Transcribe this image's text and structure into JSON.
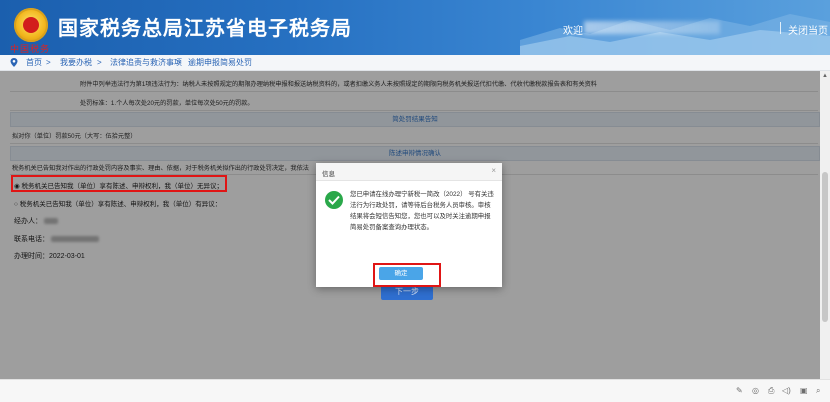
{
  "header": {
    "site_title": "国家税务总局江苏省电子税务局",
    "emblem_text": "中国税务",
    "welcome_label": "欢迎",
    "logout_label": "关闭当页"
  },
  "breadcrumb": {
    "items": [
      "首页",
      "我要办税",
      "法律追责与救济事项",
      "逾期申报简易处罚"
    ],
    "separator": ">"
  },
  "form": {
    "row1_text": "附件中列举违法行为第1项违法行为：纳税人未按照规定的期限办理纳税申报和报送纳税资料的，或者扣缴义务人未按照规定的期限向税务机关报送代扣代缴、代收代缴税款报告表和有关资料",
    "row2_text": "处罚标准：1.个人每次处20元的罚款，单位每次处50元的罚款。",
    "section_result": "简处罚结果告知",
    "fine_text": "拟对你（单位）罚款50元（大写：伍拾元整）",
    "section_statement": "陈述申辩情况确认",
    "notice_text": "税务机关已告知我对作出的行政处罚内容及事实、理由、依据，对于税务机关拟作出的行政处罚决定，我依法",
    "option1": "税务机关已告知我（单位）享有陈述、申辩权利，我（单位）无异议；",
    "option2": "税务机关已告知我（单位）享有陈述、申辩权利，我（单位）有异议：",
    "handler_label": "经办人：",
    "phone_label": "联系电话：",
    "date_label": "办理时间：",
    "date_value": "2022-03-01",
    "next_label": "下一步"
  },
  "dialog": {
    "title": "信息",
    "close": "×",
    "message": "您已申请在线办理宁新税一简改（2022） 号有关违法行为行政处罚，请等待后台税务人员审核。审核结果将会短信告知您，您也可以及时关注逾期申报简易处罚备案查询办理状态。",
    "confirm_label": "确定"
  },
  "footer": {
    "icons": [
      "pin-icon",
      "share-icon",
      "print-icon",
      "audio-icon",
      "window-icon",
      "search-icon"
    ],
    "glyphs": [
      "✎",
      "◎",
      "⎙",
      "◁)",
      "▣",
      "⌕"
    ]
  },
  "colors": {
    "header_blue": "#1b5fae",
    "accent_blue": "#3477c8",
    "highlight_red": "#e01515",
    "ok_green": "#2aa84a"
  }
}
